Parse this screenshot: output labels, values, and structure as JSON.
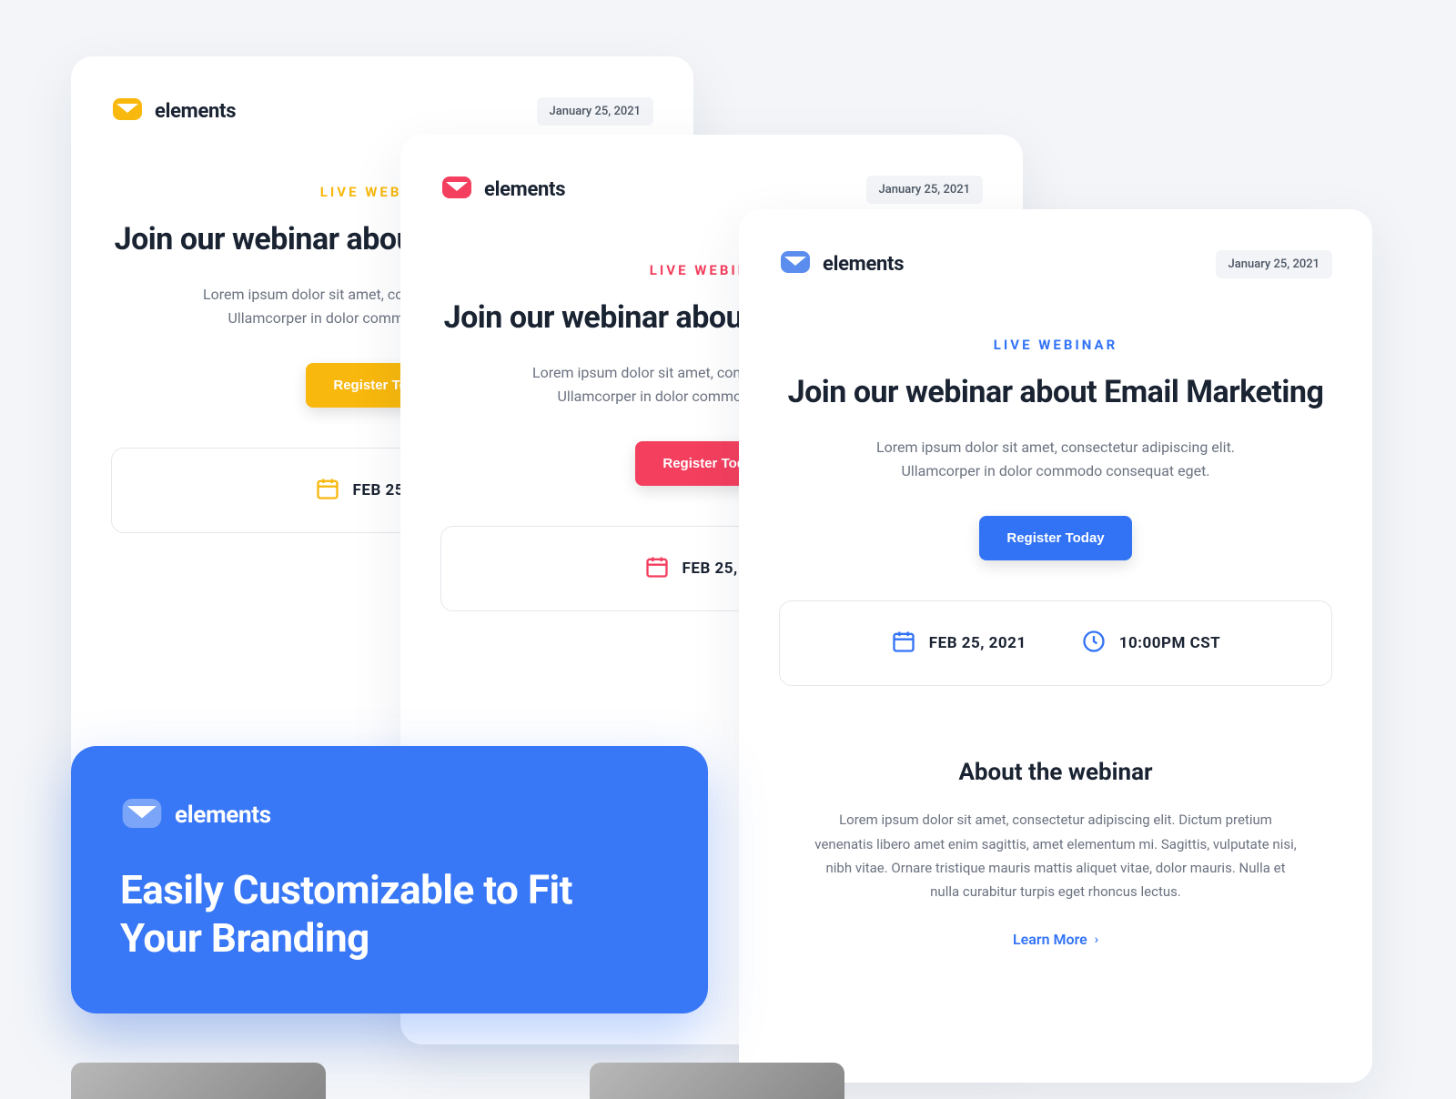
{
  "brand": "elements",
  "date_chip": "January 25, 2021",
  "eyebrow": "LIVE WEBINAR",
  "headline": "Join our webinar about Email Marketing",
  "body": "Lorem ipsum dolor sit amet, consectetur adipiscing elit. Ullamcorper in dolor commodo consequat eget.",
  "cta": "Register Today",
  "schedule": {
    "date": "FEB 25, 2021",
    "time": "10:00PM CST"
  },
  "about": {
    "title": "About the webinar",
    "body": "Lorem ipsum dolor sit amet, consectetur adipiscing elit. Dictum pretium venenatis libero amet enim sagittis, amet elementum mi. Sagittis, vulputate nisi, nibh vitae. Ornare tristique mauris mattis aliquet vitae, dolor mauris. Nulla et nulla curabitur turpis eget rhoncus lectus.",
    "learn_more": "Learn More"
  },
  "promo": {
    "brand": "elements",
    "headline": "Easily Customizable to Fit Your Branding"
  },
  "variants": [
    {
      "accent": "#f8b80d",
      "envelope_bg": "#fde8b8",
      "envelope_fg": "#f8b80d"
    },
    {
      "accent": "#f43f5e",
      "envelope_bg": "#fecdd3",
      "envelope_fg": "#f43f5e"
    },
    {
      "accent": "#3273f6",
      "envelope_bg": "#c7d9fb",
      "envelope_fg": "#3273f6"
    }
  ]
}
